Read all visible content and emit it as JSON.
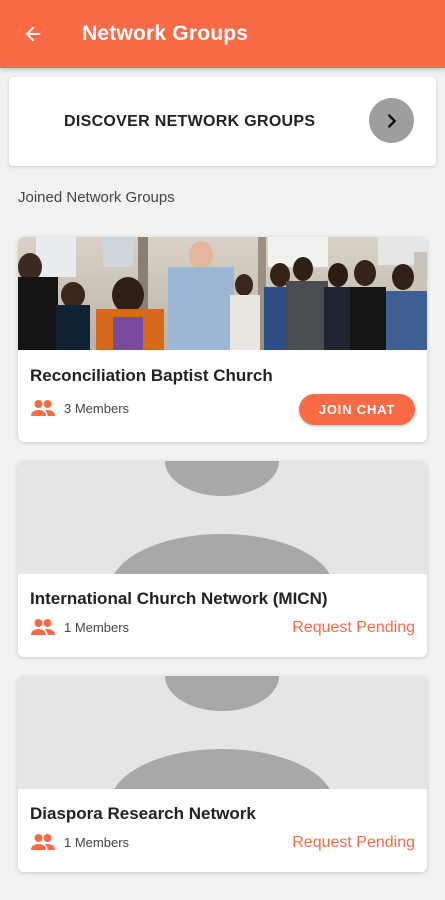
{
  "colors": {
    "accent": "#fb6a47",
    "placeholder": "#e5e5e5",
    "placeholder_shape": "#a8a8a8",
    "arrow_button": "#9e9e9e"
  },
  "appbar": {
    "title": "Network Groups",
    "back_icon": "arrow-left-icon"
  },
  "discover": {
    "label": "DISCOVER NETWORK GROUPS",
    "arrow_icon": "chevron-right-icon"
  },
  "section": {
    "title": "Joined Network Groups"
  },
  "groups": [
    {
      "name": "Reconciliation Baptist Church",
      "members": "3 Members",
      "action": "JOIN CHAT",
      "image": "congregation-photo"
    },
    {
      "name": "International Church Network (MICN)",
      "members": "1 Members",
      "status": "Request Pending",
      "image": "avatar-placeholder"
    },
    {
      "name": "Diaspora Research Network",
      "members": "1 Members",
      "status": "Request Pending",
      "image": "avatar-placeholder"
    }
  ]
}
